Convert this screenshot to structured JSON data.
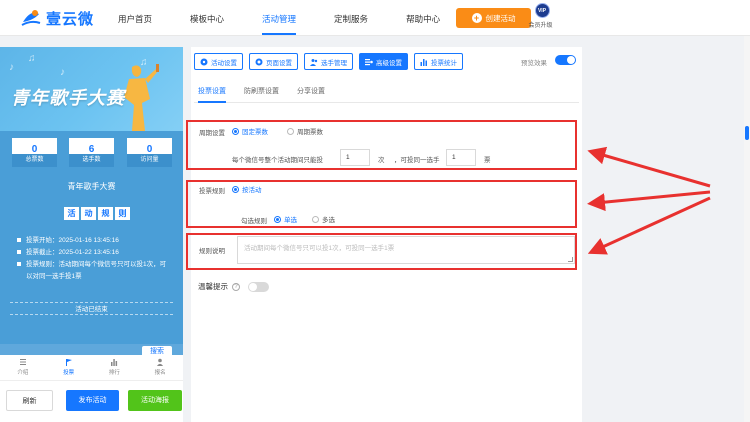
{
  "header": {
    "logo_text": "壹云微",
    "nav": [
      "用户首页",
      "模板中心",
      "活动管理",
      "定制服务",
      "帮助中心"
    ],
    "active_nav": "活动管理",
    "create_button": "创建活动",
    "vip_badge": "VIP",
    "vip_label": "会员升级"
  },
  "preview": {
    "title": "青年歌手大赛",
    "stats": [
      {
        "value": "0",
        "label": "总票数"
      },
      {
        "value": "6",
        "label": "选手数"
      },
      {
        "value": "0",
        "label": "访问量"
      }
    ],
    "event_name": "青年歌手大赛",
    "rules_heading": [
      "活",
      "动",
      "规",
      "则"
    ],
    "rules": [
      "投票开始：2025-01-16 13:45:16",
      "投票截止：2025-01-22 13:45:16",
      "投票规则：活动期间每个微信号只可以投1次，可",
      "以对同一选手投1票"
    ],
    "ended_text": "活动已结束",
    "search_button": "搜索",
    "tabs": [
      "介绍",
      "投票",
      "排行",
      "报名"
    ],
    "active_tab": "投票",
    "buttons": {
      "refresh": "刷新",
      "publish": "发布活动",
      "poster": "活动海报"
    }
  },
  "editor": {
    "toolbar": [
      {
        "label": "活动设置",
        "icon": "settings-icon"
      },
      {
        "label": "页面设置",
        "icon": "gear-icon"
      },
      {
        "label": "选手管理",
        "icon": "users-icon"
      },
      {
        "label": "高级设置",
        "icon": "advanced-icon",
        "active": true
      },
      {
        "label": "投票统计",
        "icon": "chart-icon"
      }
    ],
    "preview_label": "预览效果",
    "subtabs": [
      "投票设置",
      "防刷票设置",
      "分享设置"
    ],
    "period": {
      "label": "周期设置",
      "option_fixed": "固定票数",
      "option_cycle": "周期票数",
      "text_before": "每个微信号整个活动期间只能投",
      "total_value": "1",
      "unit_times": "次",
      "text_middle": "，可投同一选手",
      "per_value": "1",
      "unit_votes": "票"
    },
    "rule": {
      "label": "投票规则",
      "option_by_activity": "按活动",
      "check_label": "勾选规则",
      "single": "单选",
      "multi": "多选"
    },
    "description": {
      "label": "规则说明",
      "placeholder": "活动期间每个微信号只可以投1次，可投同一选手1票"
    },
    "tip_label": "温馨提示"
  },
  "colors": {
    "accent": "#1677ff",
    "orange": "#fa8c16",
    "green": "#52c41a",
    "annotation_red": "#e8312f"
  }
}
